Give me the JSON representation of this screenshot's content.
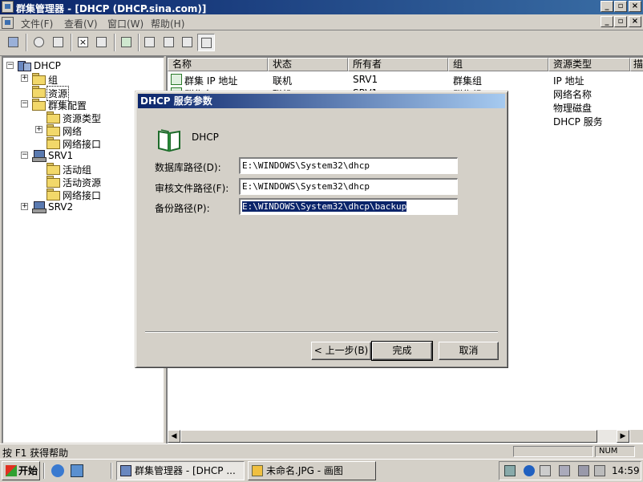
{
  "window": {
    "title": "群集管理器 - [DHCP (DHCP.sina.com)]",
    "min_label": "_",
    "restore_label": "▫",
    "close_label": "×"
  },
  "menu": [
    "文件(F)",
    "查看(V)",
    "窗口(W)",
    "帮助(H)"
  ],
  "tree": {
    "root": "DHCP",
    "groups": "组",
    "resources": "资源",
    "cluster_config": "群集配置",
    "resource_types": "资源类型",
    "networks": "网络",
    "net_interfaces": "网络接口",
    "srv1": "SRV1",
    "active_groups": "活动组",
    "active_resources": "活动资源",
    "srv1_net_interfaces": "网络接口",
    "srv2": "SRV2"
  },
  "list": {
    "columns": [
      "名称",
      "状态",
      "所有者",
      "组",
      "资源类型",
      "描"
    ],
    "rows": [
      {
        "name": "群集 IP 地址",
        "status": "联机",
        "owner": "SRV1",
        "group": "群集组",
        "type": "IP 地址"
      },
      {
        "name": "群集名",
        "status": "联机",
        "owner": "SRV1",
        "group": "群集组",
        "type": "网络名称"
      },
      {
        "name": "",
        "status": "",
        "owner": "",
        "group": "",
        "type": "物理磁盘"
      },
      {
        "name": "",
        "status": "",
        "owner": "",
        "group": "",
        "type": "DHCP 服务"
      }
    ]
  },
  "dialog": {
    "title": "DHCP 服务参数",
    "resource_name": "DHCP",
    "db_label": "数据库路径(D):",
    "db_value": "E:\\WINDOWS\\System32\\dhcp",
    "audit_label": "审核文件路径(F):",
    "audit_value": "E:\\WINDOWS\\System32\\dhcp",
    "backup_label": "备份路径(P):",
    "backup_value": "E:\\WINDOWS\\System32\\dhcp\\backup",
    "back_button": "< 上一步(B)",
    "finish_button": "完成",
    "cancel_button": "取消"
  },
  "status": {
    "help_text": "按 F1 获得帮助",
    "num": "NUM"
  },
  "taskbar": {
    "start": "开始",
    "task1": "群集管理器 - [DHCP ...",
    "task2": "未命名.JPG - 画图",
    "clock": "14:59"
  }
}
